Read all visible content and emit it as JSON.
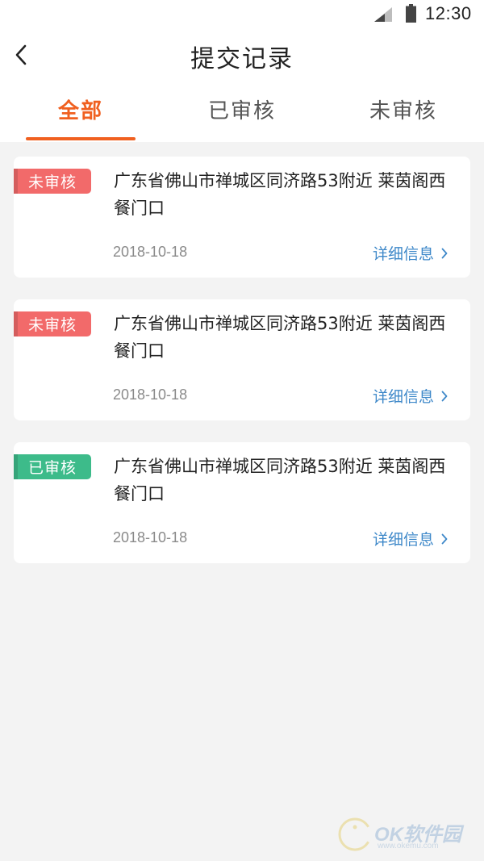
{
  "status_bar": {
    "time": "12:30",
    "icons": [
      "signal-icon",
      "battery-icon"
    ]
  },
  "header": {
    "title": "提交记录",
    "back_icon": "chevron-left-icon"
  },
  "tabs": [
    {
      "label": "全部",
      "active": true
    },
    {
      "label": "已审核",
      "active": false
    },
    {
      "label": "未审核",
      "active": false
    }
  ],
  "colors": {
    "accent": "#f06020",
    "pending": "#f26a6a",
    "approved": "#3dbb8a",
    "link": "#3e88c9"
  },
  "records": [
    {
      "status": "未审核",
      "status_type": "pending",
      "address": "广东省佛山市禅城区同济路53附近 莱茵阁西餐门口",
      "date": "2018-10-18",
      "detail_label": "详细信息"
    },
    {
      "status": "未审核",
      "status_type": "pending",
      "address": "广东省佛山市禅城区同济路53附近 莱茵阁西餐门口",
      "date": "2018-10-18",
      "detail_label": "详细信息"
    },
    {
      "status": "已审核",
      "status_type": "approved",
      "address": "广东省佛山市禅城区同济路53附近 莱茵阁西餐门口",
      "date": "2018-10-18",
      "detail_label": "详细信息"
    }
  ],
  "watermark": {
    "text": "OK软件园",
    "sub": "www.okemu.com"
  }
}
